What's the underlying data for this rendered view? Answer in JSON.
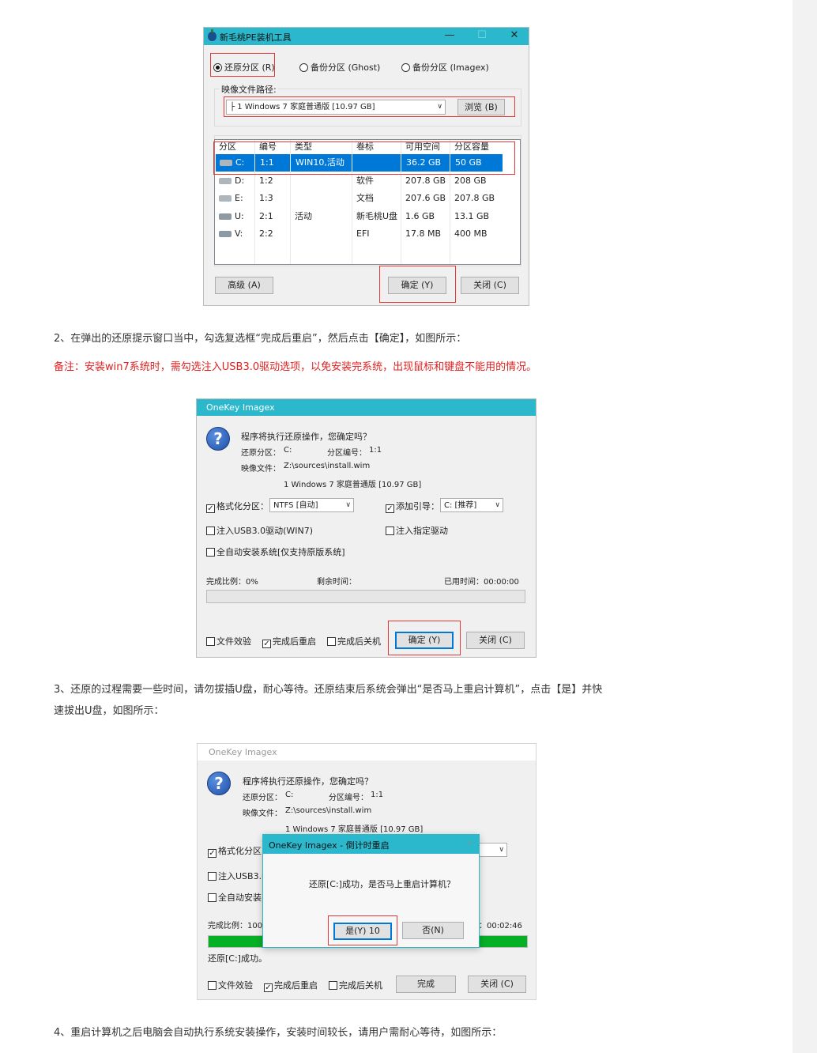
{
  "window1": {
    "title": "新毛桃PE装机工具",
    "controls": {
      "minimize": "—",
      "maximize": "☐",
      "close": "✕"
    },
    "radios": [
      "还原分区 (R)",
      "备份分区 (Ghost)",
      "备份分区 (Imagex)"
    ],
    "image_path_label": "映像文件路径:",
    "image_path_value": "├ 1 Windows 7 家庭普通版 [10.97 GB]",
    "browse_button": "浏览 (B)",
    "table": {
      "headers": [
        "分区",
        "编号",
        "类型",
        "卷标",
        "可用空间",
        "分区容量"
      ],
      "rows": [
        [
          "C:",
          "1:1",
          "WIN10,活动",
          "",
          "36.2 GB",
          "50 GB"
        ],
        [
          "D:",
          "1:2",
          "",
          "软件",
          "207.8 GB",
          "208 GB"
        ],
        [
          "E:",
          "1:3",
          "",
          "文档",
          "207.6 GB",
          "207.8 GB"
        ],
        [
          "U:",
          "2:1",
          "活动",
          "新毛桃U盘",
          "1.6 GB",
          "13.1 GB"
        ],
        [
          "V:",
          "2:2",
          "",
          "EFI",
          "17.8 MB",
          "400 MB"
        ]
      ]
    },
    "advanced_button": "高级 (A)",
    "ok_button": "确定 (Y)",
    "close_button": "关闭 (C)"
  },
  "step2": "2、在弹出的还原提示窗口当中，勾选复选框“完成后重启”，然后点击【确定】，如图所示：",
  "note": "备注：安装win7系统时，需勾选注入USB3.0驱动选项，以免安装完系统，出现鼠标和键盘不能用的情况。",
  "window2": {
    "title": "OneKey Imagex",
    "question": "程序将执行还原操作，您确定吗？",
    "restore_partition_label": "还原分区：",
    "restore_partition_value": "C:",
    "partition_number_label": "分区编号：",
    "partition_number_value": "1:1",
    "image_file_label": "映像文件：",
    "image_file_value": "Z:\\sources\\install.wim",
    "image_version": "1 Windows 7 家庭普通版 [10.97 GB]",
    "format_label": "格式化分区：",
    "format_value": "NTFS [自动]",
    "boot_label": "添加引导：",
    "boot_value": "C: [推荐]",
    "usb3_label": "注入USB3.0驱动(WIN7)",
    "inject_driver_label": "注入指定驱动",
    "auto_install_label": "全自动安装系统[仅支持原版系统]",
    "progress_label": "完成比例：0%",
    "remaining_label": "剩余时间：",
    "elapsed_label": "已用时间：00:00:00",
    "progress": 0,
    "verify_label": "文件效验",
    "reboot_label": "完成后重启",
    "shutdown_label": "完成后关机",
    "ok_button": "确定 (Y)",
    "close_button": "关闭 (C)"
  },
  "step3_line1": "3、还原的过程需要一些时间，请勿拔插U盘，耐心等待。还原结束后系统会弹出“是否马上重启计算机”，点击【是】并快",
  "step3_line2": "速拔出U盘，如图所示：",
  "window3": {
    "title": "OneKey Imagex",
    "question": "程序将执行还原操作，您确定吗？",
    "restore_partition_label": "还原分区：",
    "restore_partition_value": "C:",
    "partition_number_label": "分区编号：",
    "partition_number_value": "1:1",
    "image_file_label": "映像文件：",
    "image_file_value": "Z:\\sources\\install.wim",
    "image_version": "1 Windows 7 家庭普通版 [10.97 GB]",
    "format_label": "格式化分区",
    "combo_value": "]",
    "usb3_label": "注入USB3.0",
    "auto_install_label": "全自动安装",
    "progress_label": "完成比例：100",
    "elapsed_label": "：00:02:46",
    "progress": 100,
    "status": "还原[C:]成功。",
    "verify_label": "文件效验",
    "reboot_label": "完成后重启",
    "shutdown_label": "完成后关机",
    "finish_button": "完成",
    "close_button": "关闭 (C)"
  },
  "dialog": {
    "title": "OneKey Imagex - 倒计时重启",
    "close": "✕",
    "message": "还原[C:]成功，是否马上重启计算机？",
    "yes_button": "是(Y) 10",
    "no_button": "否(N)"
  },
  "step4": "4、重启计算机之后电脑会自动执行系统安装操作，安装时间较长，请用户需耐心等待，如图所示：",
  "colors": {
    "titlebar": "#2bb8cc",
    "highlight": "#e53935",
    "selection": "#0078d7",
    "progress": "#06b025"
  }
}
